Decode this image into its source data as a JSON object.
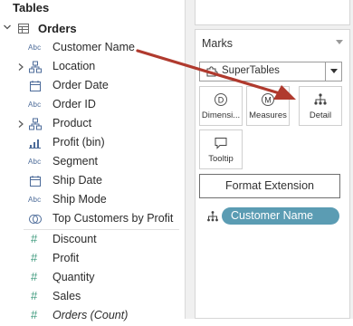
{
  "tables_title": "Tables",
  "datasource": {
    "name": "Orders"
  },
  "fields": [
    {
      "label": "Customer Name",
      "type": "Abc",
      "expandable": false,
      "italic": false
    },
    {
      "label": "Location",
      "type": "hierarchy-icon",
      "expandable": true,
      "italic": false
    },
    {
      "label": "Order Date",
      "type": "calendar-icon",
      "expandable": false,
      "italic": false
    },
    {
      "label": "Order ID",
      "type": "Abc",
      "expandable": false,
      "italic": false
    },
    {
      "label": "Product",
      "type": "hierarchy-icon",
      "expandable": true,
      "italic": false
    },
    {
      "label": "Profit (bin)",
      "type": "bin-icon",
      "expandable": false,
      "italic": false
    },
    {
      "label": "Segment",
      "type": "Abc",
      "expandable": false,
      "italic": false
    },
    {
      "label": "Ship Date",
      "type": "calendar-icon",
      "expandable": false,
      "italic": false
    },
    {
      "label": "Ship Mode",
      "type": "Abc",
      "expandable": false,
      "italic": false
    },
    {
      "label": "Top Customers by Profit",
      "type": "set-icon",
      "expandable": false,
      "italic": false
    },
    {
      "label": "Discount",
      "type": "#",
      "expandable": false,
      "italic": false
    },
    {
      "label": "Profit",
      "type": "#",
      "expandable": false,
      "italic": false
    },
    {
      "label": "Quantity",
      "type": "#",
      "expandable": false,
      "italic": false
    },
    {
      "label": "Sales",
      "type": "#",
      "expandable": false,
      "italic": false
    },
    {
      "label": "Orders (Count)",
      "type": "#",
      "expandable": false,
      "italic": true
    }
  ],
  "marks": {
    "title": "Marks",
    "mark_type": "SuperTables",
    "cards": [
      {
        "label": "Dimensi...",
        "icon": "dimension-icon",
        "letter": "D"
      },
      {
        "label": "Measures",
        "icon": "measure-icon",
        "letter": "M"
      },
      {
        "label": "Detail",
        "icon": "detail-icon"
      },
      {
        "label": "Tooltip",
        "icon": "tooltip-icon"
      }
    ],
    "format_button": "Format Extension",
    "pill": {
      "label": "Customer Name",
      "icon": "detail-icon"
    }
  },
  "colors": {
    "arrow": "#b03a2e",
    "pill": "#5b9cb3",
    "abc_icon": "#4c6b99",
    "measure_icon": "#3e9a7d"
  }
}
